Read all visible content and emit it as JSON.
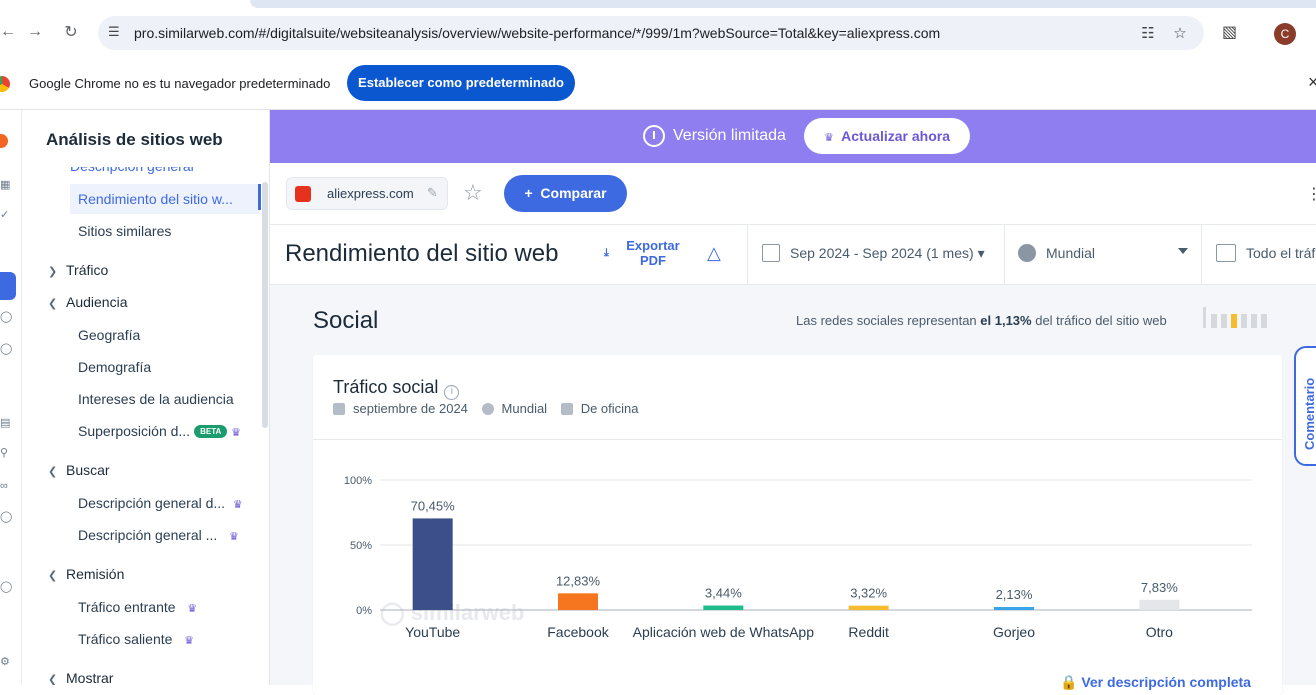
{
  "browser": {
    "url": "pro.similarweb.com/#/digitalsuite/websiteanalysis/overview/website-performance/*/999/1m?webSource=Total&key=aliexpress.com",
    "profile_initial": "C",
    "infobar_message": "Google Chrome no es tu navegador predeterminado",
    "infobar_button": "Establecer como predeterminado"
  },
  "sidebar": {
    "title": "Análisis de sitios web",
    "cut_item": "Descripción general",
    "items_top": [
      {
        "label": "Rendimiento del sitio w..."
      },
      {
        "label": "Sitios similares"
      }
    ],
    "groups": {
      "trafico": "Tráfico",
      "audiencia": "Audiencia",
      "buscar": "Buscar",
      "remision": "Remisión",
      "mostrar": "Mostrar"
    },
    "audiencia_items": [
      "Geografía",
      "Demografía",
      "Intereses de la audiencia",
      "Superposición d..."
    ],
    "beta_label": "BETA",
    "buscar_items": [
      "Descripción general d...",
      "Descripción general ..."
    ],
    "remision_items": [
      "Tráfico entrante",
      "Tráfico saliente"
    ]
  },
  "banner": {
    "label": "Versión limitada",
    "upgrade": "Actualizar ahora"
  },
  "toolbar": {
    "site": "aliexpress.com",
    "compare": "Comparar"
  },
  "header": {
    "title": "Rendimiento del sitio web",
    "export": "Exportar PDF",
    "date_range": "Sep 2024 - Sep 2024 (1 mes)",
    "region": "Mundial",
    "device": "Todo el tráfico"
  },
  "section": {
    "title": "Social",
    "share_prefix": "Las redes sociales representan ",
    "share_value": "el 1,13%",
    "share_suffix": " del tráfico del sitio web"
  },
  "card": {
    "title": "Tráfico social",
    "date": "septiembre de 2024",
    "region": "Mundial",
    "device": "De oficina",
    "see_more": "Ver descripción completa",
    "feedback": "Comentario",
    "watermark": "similarweb"
  },
  "chart_data": {
    "type": "bar",
    "categories": [
      "YouTube",
      "Facebook",
      "Aplicación web de WhatsApp",
      "Reddit",
      "Gorjeo",
      "Otro"
    ],
    "values": [
      70.45,
      12.83,
      3.44,
      3.32,
      2.13,
      7.83
    ],
    "value_labels": [
      "70,45%",
      "12,83%",
      "3,44%",
      "3,32%",
      "2,13%",
      "7,83%"
    ],
    "colors": [
      "#3d4f8a",
      "#f6761f",
      "#1fbd8c",
      "#f5bd2e",
      "#38a3e6",
      "#e4e6ea"
    ],
    "ylim": [
      0,
      100
    ],
    "yticks": [
      0,
      50,
      100
    ],
    "ytick_labels": [
      "0%",
      "50%",
      "100%"
    ],
    "grid": true
  }
}
